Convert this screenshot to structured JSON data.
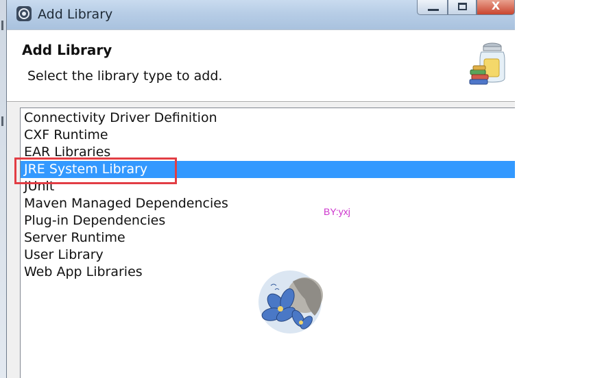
{
  "window": {
    "title": "Add Library",
    "controls": {
      "minimize_icon": "minimize-icon",
      "maximize_icon": "maximize-icon",
      "close_label": "X"
    }
  },
  "header": {
    "title": "Add Library",
    "description": "Select the library type to add.",
    "icon": "library-jar-icon"
  },
  "library_types": [
    {
      "label": "Connectivity Driver Definition",
      "selected": false
    },
    {
      "label": "CXF Runtime",
      "selected": false
    },
    {
      "label": "EAR Libraries",
      "selected": false
    },
    {
      "label": "JRE System Library",
      "selected": true
    },
    {
      "label": "JUnit",
      "selected": false
    },
    {
      "label": "Maven Managed Dependencies",
      "selected": false
    },
    {
      "label": "Plug-in Dependencies",
      "selected": false
    },
    {
      "label": "Server Runtime",
      "selected": false
    },
    {
      "label": "User Library",
      "selected": false
    },
    {
      "label": "Web App Libraries",
      "selected": false
    }
  ],
  "watermark": {
    "text": "BY:yxj",
    "color": "#cc33cc"
  },
  "colors": {
    "selection": "#3399ff",
    "annotation_box": "#e23d44"
  }
}
